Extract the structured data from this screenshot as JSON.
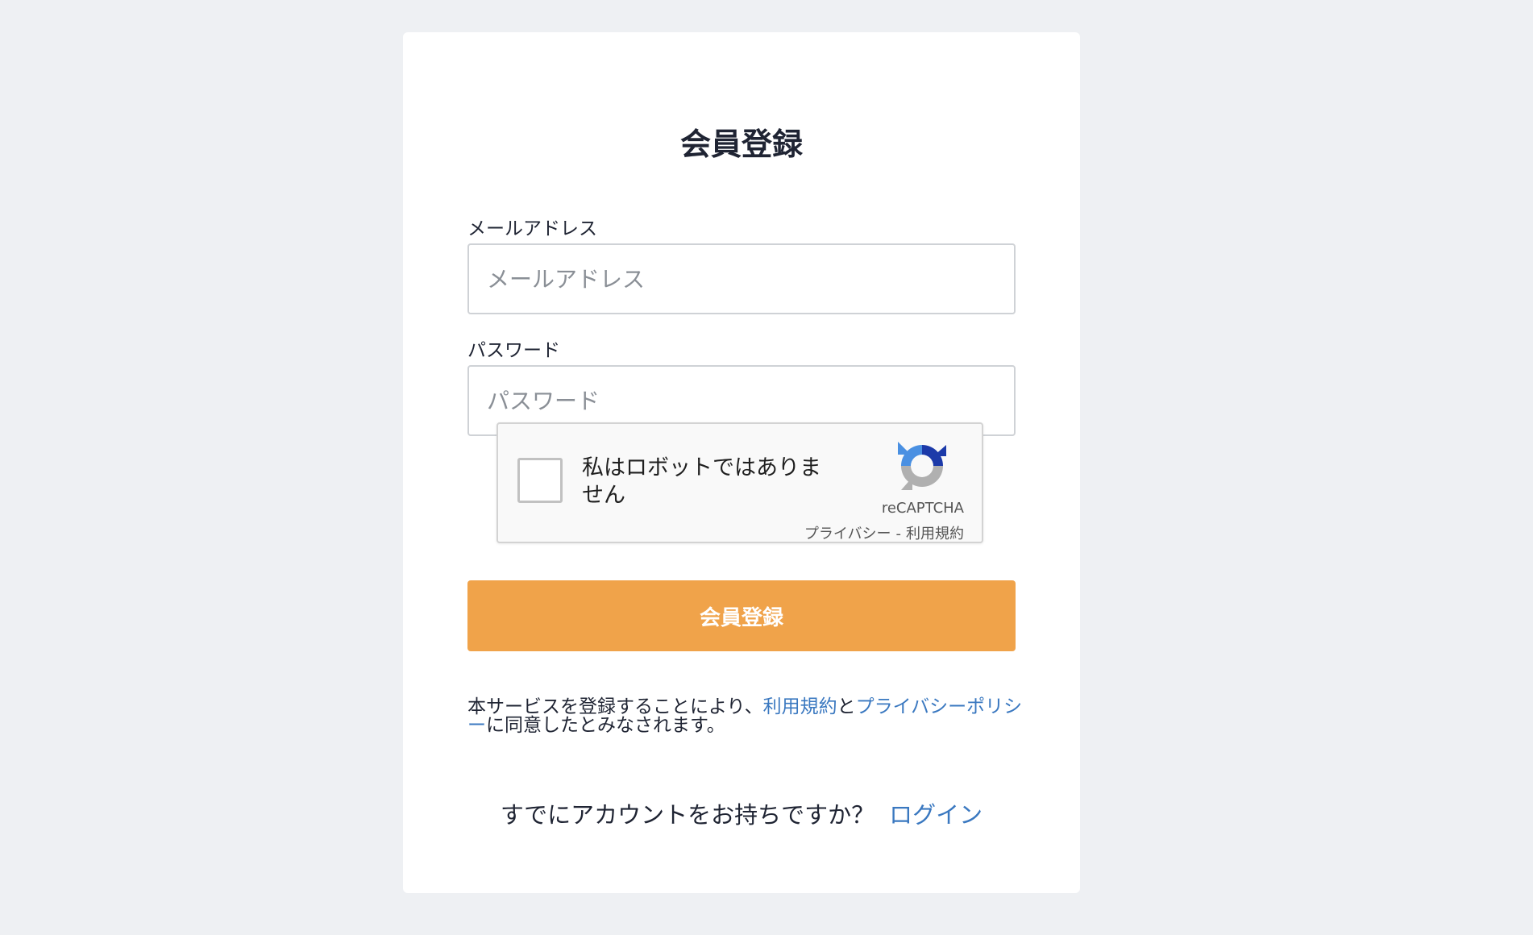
{
  "form": {
    "title": "会員登録",
    "email": {
      "label": "メールアドレス",
      "placeholder": "メールアドレス",
      "value": ""
    },
    "password": {
      "label": "パスワード",
      "placeholder": "パスワード",
      "value": ""
    },
    "recaptcha": {
      "label": "私はロボットではありません",
      "brand": "reCAPTCHA",
      "privacy_link": "プライバシー",
      "separator": "-",
      "terms_link": "利用規約",
      "logo_icon": "recaptcha-logo-icon"
    },
    "submit_label": "会員登録",
    "terms_notice": {
      "prefix": "本サービスを登録することにより、",
      "terms_link": "利用規約",
      "connector": "と",
      "privacy_link": "プライバシーポリシー",
      "suffix": "に同意したとみなされます。"
    },
    "login_prompt": {
      "text": "すでにアカウントをお持ちですか？",
      "link": "ログイン"
    }
  },
  "colors": {
    "background": "#eef0f3",
    "card": "#ffffff",
    "accent_button": "#f0a34a",
    "link": "#3a78c0",
    "text": "#1f2433"
  }
}
